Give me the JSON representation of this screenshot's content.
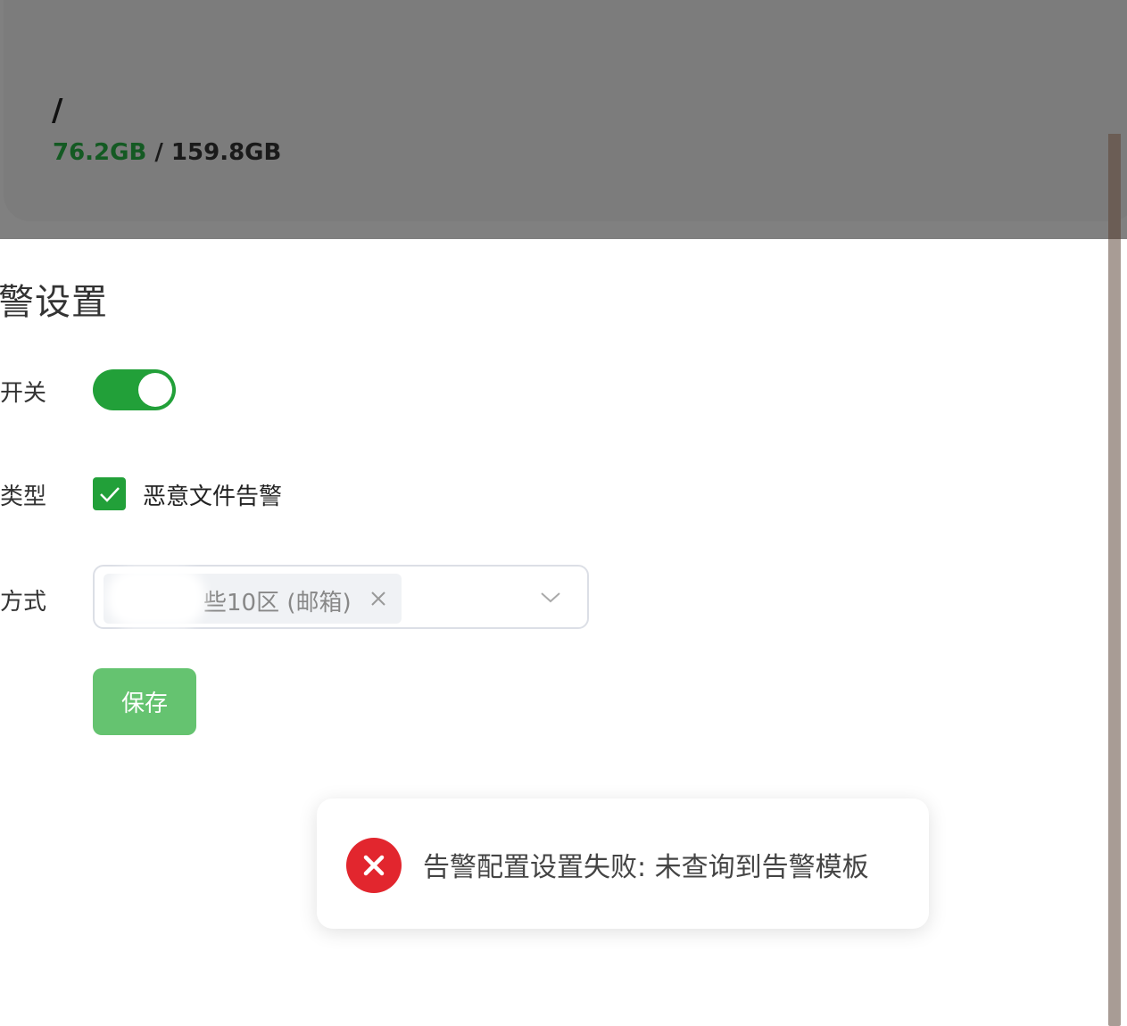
{
  "disk": {
    "path": "/",
    "used": "76.2GB",
    "separator": " / ",
    "total": "159.8GB"
  },
  "alert_settings": {
    "title": "警设置",
    "switch_label": "开关",
    "switch_on": true,
    "type_label": "类型",
    "type_option": "恶意文件告警",
    "type_checked": true,
    "method_label": "方式",
    "method_tag": "些10区 (邮箱)",
    "save_label": "保存"
  },
  "toast": {
    "type": "error",
    "message": "告警配置设置失败: 未查询到告警模板"
  },
  "colors": {
    "accent": "#22a039",
    "save_button": "#65c370",
    "error": "#e2262e",
    "used_text": "#145a23"
  }
}
